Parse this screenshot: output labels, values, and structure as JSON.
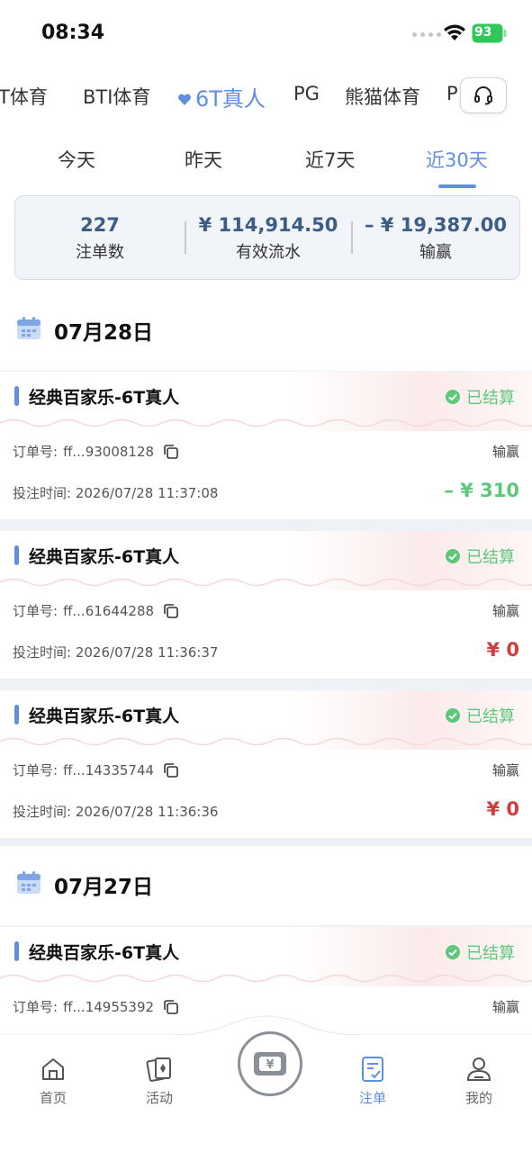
{
  "status_bar": {
    "time": "08:34",
    "battery": "93"
  },
  "providers": {
    "items": [
      {
        "label": "T体育"
      },
      {
        "label": "BTI体育"
      },
      {
        "label": "6T真人"
      },
      {
        "label": "PG"
      },
      {
        "label": "熊猫体育"
      },
      {
        "label": "P"
      }
    ],
    "active": "6T真人",
    "support_icon": "headset-icon"
  },
  "ranges": {
    "items": [
      {
        "label": "今天"
      },
      {
        "label": "昨天"
      },
      {
        "label": "近7天"
      },
      {
        "label": "近30天"
      }
    ],
    "active": "近30天"
  },
  "summary": {
    "count_value": "227",
    "count_label": "注单数",
    "turnover_value": "¥ 114,914.50",
    "turnover_label": "有效流水",
    "winloss_value": "– ¥ 19,387.00",
    "winloss_label": "输赢"
  },
  "days": [
    {
      "date": "07月28日",
      "orders": [
        {
          "title": "经典百家乐-6T真人",
          "status": "已结算",
          "order_label": "订单号:",
          "order_no": "ff...93008128",
          "winloss_label": "输赢",
          "time_label": "投注时间:",
          "time": "2026/07/28 11:37:08",
          "amount": "– ¥ 310"
        },
        {
          "title": "经典百家乐-6T真人",
          "status": "已结算",
          "order_label": "订单号:",
          "order_no": "ff...61644288",
          "winloss_label": "输赢",
          "time_label": "投注时间:",
          "time": "2026/07/28 11:36:37",
          "amount": "¥ 0"
        },
        {
          "title": "经典百家乐-6T真人",
          "status": "已结算",
          "order_label": "订单号:",
          "order_no": "ff...14335744",
          "winloss_label": "输赢",
          "time_label": "投注时间:",
          "time": "2026/07/28 11:36:36",
          "amount": "¥ 0"
        }
      ]
    },
    {
      "date": "07月27日",
      "orders": [
        {
          "title": "经典百家乐-6T真人",
          "status": "已结算",
          "order_label": "订单号:",
          "order_no": "ff...14955392",
          "winloss_label": "输赢"
        }
      ]
    }
  ],
  "bottom_nav": {
    "items": [
      {
        "label": "首页",
        "icon": "home-icon"
      },
      {
        "label": "活动",
        "icon": "cards-icon"
      },
      {
        "label": "",
        "icon": "wallet-yen-icon"
      },
      {
        "label": "注单",
        "icon": "bet-slip-icon"
      },
      {
        "label": "我的",
        "icon": "profile-icon"
      }
    ],
    "active": "注单",
    "center_symbol": "¥"
  },
  "colors": {
    "accent": "#5f8fe0",
    "settled": "#5cc87a",
    "loss_amount": "#5cc87a",
    "zero_amount": "#d23c3c",
    "summary_value": "#3c5d86"
  }
}
